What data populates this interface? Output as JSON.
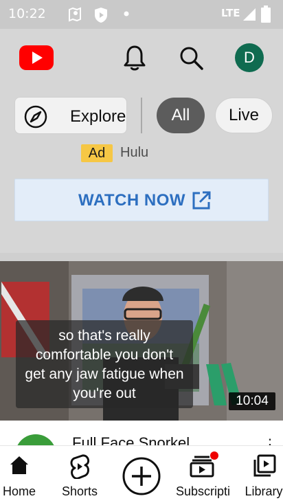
{
  "status_bar": {
    "time": "10:22",
    "network": "LTE"
  },
  "app_bar": {
    "logo_icon": "youtube-logo-icon",
    "avatar_letter": "D",
    "avatar_color": "#0f6b50"
  },
  "chips": {
    "explore_label": "Explore",
    "all_label": "All",
    "live_label": "Live"
  },
  "ad": {
    "badge": "Ad",
    "advertiser": "Hulu",
    "cta_label": "WATCH NOW",
    "cta_color": "#2d6fc0",
    "badge_color": "#f6c745"
  },
  "video": {
    "caption_lines": [
      "so that's really",
      "comfortable you don't",
      "get any jaw fatigue when",
      "you're out"
    ],
    "duration": "10:04",
    "next_title": "Full Face Snorkel"
  },
  "bottom_nav": {
    "items": [
      {
        "label": "Home",
        "icon": "home-icon"
      },
      {
        "label": "Shorts",
        "icon": "shorts-icon"
      },
      {
        "label": "",
        "icon": "create-plus-icon"
      },
      {
        "label": "Subscriptions",
        "icon": "subscriptions-icon"
      },
      {
        "label": "Library",
        "icon": "library-icon"
      }
    ]
  }
}
